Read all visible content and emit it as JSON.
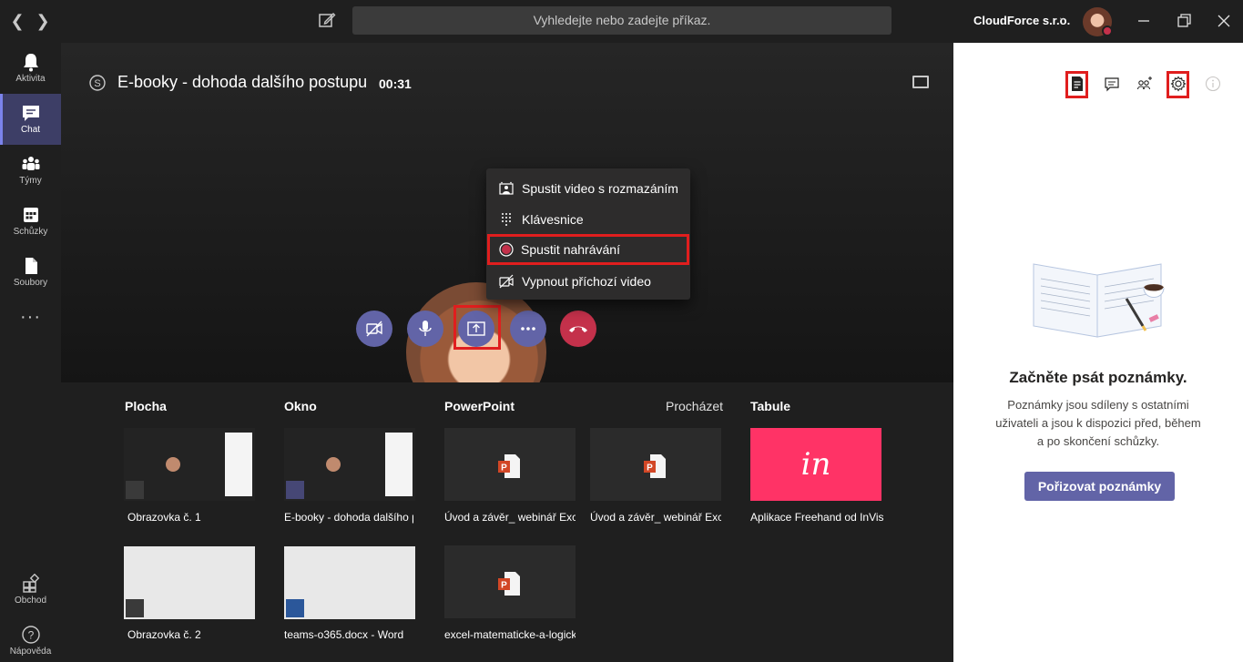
{
  "titlebar": {
    "search_placeholder": "Vyhledejte nebo zadejte příkaz.",
    "org_name": "CloudForce s.r.o."
  },
  "rail": {
    "items": [
      {
        "label": "Aktivita",
        "icon": "bell-icon"
      },
      {
        "label": "Chat",
        "icon": "chat-icon"
      },
      {
        "label": "Týmy",
        "icon": "teams-icon"
      },
      {
        "label": "Schůzky",
        "icon": "calendar-icon"
      },
      {
        "label": "Soubory",
        "icon": "file-icon"
      },
      {
        "label": "Obchod",
        "icon": "store-icon"
      },
      {
        "label": "Nápověda",
        "icon": "help-icon"
      }
    ],
    "more": "···"
  },
  "meeting": {
    "title": "E-booky - dohoda dalšího postupu",
    "time": "00:31"
  },
  "menu": {
    "items": [
      {
        "label": "Spustit video s rozmazáním",
        "icon": "blur-background-icon"
      },
      {
        "label": "Klávesnice",
        "icon": "dialpad-icon"
      },
      {
        "label": "Spustit nahrávání",
        "icon": "record-icon"
      },
      {
        "label": "Vypnout příchozí video",
        "icon": "video-off-icon"
      }
    ]
  },
  "tray": {
    "headers": {
      "desktop": "Plocha",
      "window": "Okno",
      "powerpoint": "PowerPoint",
      "browse": "Procházet",
      "whiteboard": "Tabule"
    },
    "items": [
      {
        "label": "Obrazovka č. 1"
      },
      {
        "label": "E-booky - dohoda dalšího postupu"
      },
      {
        "label": "Úvod a závěr_ webinář Excel"
      },
      {
        "label": "Úvod a závěr_ webinář Excel"
      },
      {
        "label": "Aplikace Freehand od InVision"
      },
      {
        "label": "Obrazovka č. 2"
      },
      {
        "label": "teams-o365.docx - Word"
      },
      {
        "label": "excel-matematicke-a-logicke"
      }
    ],
    "invision_logo": "in"
  },
  "notes": {
    "title": "Začněte psát poznámky.",
    "description": "Poznámky jsou sdíleny s ostatními uživateli a jsou k dispozici před, během a po skončení schůzky.",
    "button": "Pořizovat poznámky"
  },
  "colors": {
    "accent": "#6264a7",
    "end_call": "#c4314b",
    "highlight": "#e01e1e",
    "invision": "#ff3366"
  }
}
